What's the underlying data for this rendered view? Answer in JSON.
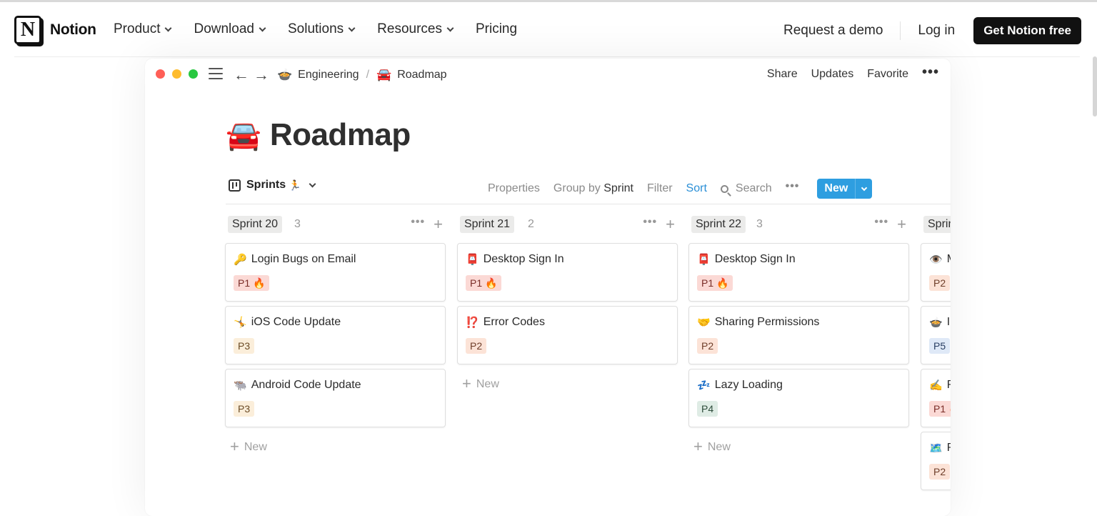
{
  "site": {
    "brand": "Notion",
    "logo_letter": "N",
    "nav": [
      {
        "label": "Product",
        "dropdown": true
      },
      {
        "label": "Download",
        "dropdown": true
      },
      {
        "label": "Solutions",
        "dropdown": true
      },
      {
        "label": "Resources",
        "dropdown": true
      },
      {
        "label": "Pricing",
        "dropdown": false
      }
    ],
    "request_demo": "Request a demo",
    "login": "Log in",
    "cta": "Get Notion free"
  },
  "window": {
    "back_arrow": "←",
    "forward_arrow": "→",
    "breadcrumb": [
      {
        "emoji": "🍲",
        "label": "Engineering"
      },
      {
        "emoji": "🚘",
        "label": "Roadmap"
      }
    ],
    "breadcrumb_separator": "/",
    "actions": [
      "Share",
      "Updates",
      "Favorite"
    ],
    "more": "•••"
  },
  "page": {
    "emoji": "🚘",
    "title": "Roadmap"
  },
  "toolbar": {
    "view_name": "Sprints",
    "view_emoji": "🏃",
    "properties": "Properties",
    "group_by_label": "Group by",
    "group_by_value": "Sprint",
    "filter": "Filter",
    "sort": "Sort",
    "search": "Search",
    "more": "•••",
    "new": "New"
  },
  "board": {
    "add_label": "New",
    "columns": [
      {
        "name": "Sprint 20",
        "count": "3",
        "cards": [
          {
            "emoji": "🔑",
            "title": "Login Bugs on Email",
            "tag": "P1 🔥",
            "tag_class": "p1"
          },
          {
            "emoji": "🤸",
            "title": "iOS Code Update",
            "tag": "P3",
            "tag_class": "p3"
          },
          {
            "emoji": "🐃",
            "title": "Android Code Update",
            "tag": "P3",
            "tag_class": "p3"
          }
        ]
      },
      {
        "name": "Sprint 21",
        "count": "2",
        "cards": [
          {
            "emoji": "📮",
            "title": "Desktop Sign In",
            "tag": "P1 🔥",
            "tag_class": "p1"
          },
          {
            "emoji": "⁉️",
            "title": "Error Codes",
            "tag": "P2",
            "tag_class": "p2"
          }
        ]
      },
      {
        "name": "Sprint 22",
        "count": "3",
        "cards": [
          {
            "emoji": "📮",
            "title": "Desktop Sign In",
            "tag": "P1 🔥",
            "tag_class": "p1"
          },
          {
            "emoji": "🤝",
            "title": "Sharing Permissions",
            "tag": "P2",
            "tag_class": "p2"
          },
          {
            "emoji": "💤",
            "title": "Lazy Loading",
            "tag": "P4",
            "tag_class": "p4"
          }
        ]
      },
      {
        "name": "Sprin",
        "count": "",
        "cards": [
          {
            "emoji": "👁️",
            "title": "M",
            "tag": "P2",
            "tag_class": "p2"
          },
          {
            "emoji": "🍲",
            "title": "I",
            "tag": "P5",
            "tag_class": "p5"
          },
          {
            "emoji": "✍️",
            "title": "R",
            "tag": "P1 🔥",
            "tag_class": "p1"
          },
          {
            "emoji": "🗺️",
            "title": "R",
            "tag": "P2",
            "tag_class": "p2"
          }
        ]
      }
    ]
  }
}
